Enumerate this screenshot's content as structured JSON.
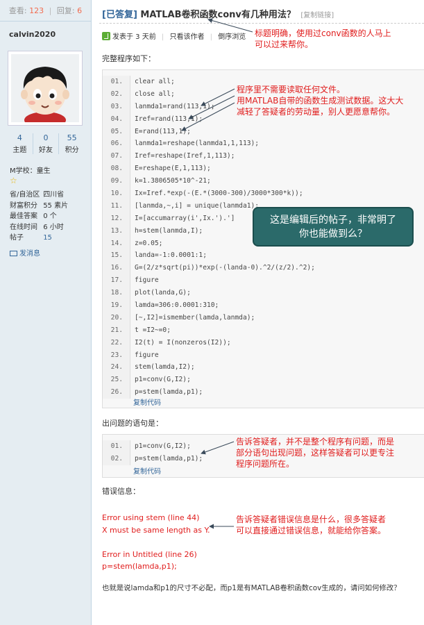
{
  "stats": {
    "views_label": "查看:",
    "views": "123",
    "replies_label": "回复:",
    "replies": "6"
  },
  "user": {
    "name": "calvin2020",
    "stats": [
      {
        "value": "4",
        "label": "主题"
      },
      {
        "value": "0",
        "label": "好友"
      },
      {
        "value": "55",
        "label": "积分"
      }
    ],
    "school": "M学校：童生",
    "profile": [
      {
        "key": "省/自治区",
        "value": "四川省",
        "blue": false
      },
      {
        "key": "财富积分",
        "value": "55 素片",
        "blue": false
      },
      {
        "key": "最佳答案",
        "value": "0 个",
        "blue": false
      },
      {
        "key": "在线时间",
        "value": "6 小时",
        "blue": false
      },
      {
        "key": "帖子",
        "value": "15",
        "blue": true
      }
    ],
    "send_message": "发消息"
  },
  "post": {
    "tag": "[已答复]",
    "title": " MATLAB卷积函数conv有几种用法？",
    "copy_link": "[复制链接]",
    "meta": {
      "posted": "发表于 3 天前",
      "only_author": "只看该作者",
      "reverse": "倒序浏览"
    },
    "intro": "完整程序如下：",
    "code1": [
      {
        "n": "01.",
        "t": "clear all;"
      },
      {
        "n": "02.",
        "t": "close all;"
      },
      {
        "n": "03.",
        "t": "lanmda1=rand(113,1);"
      },
      {
        "n": "04.",
        "t": "Iref=rand(113,1);"
      },
      {
        "n": "05.",
        "t": "E=rand(113,1);"
      },
      {
        "n": "06.",
        "t": "lanmda1=reshape(lanmda1,1,113);"
      },
      {
        "n": "07.",
        "t": "Iref=reshape(Iref,1,113);"
      },
      {
        "n": "08.",
        "t": "E=reshape(E,1,113);"
      },
      {
        "n": "09.",
        "t": "k=1.3806505*10^-21;"
      },
      {
        "n": "10.",
        "t": "Ix=Iref.*exp(-(E.*(3000-300)/3000*300*k));"
      },
      {
        "n": "11.",
        "t": "[lanmda,~,i] = unique(lanmda1);"
      },
      {
        "n": "12.",
        "t": "I=[accumarray(i',Ix.').']"
      },
      {
        "n": "13.",
        "t": "h=stem(lanmda,I);"
      },
      {
        "n": "14.",
        "t": "z=0.05;"
      },
      {
        "n": "15.",
        "t": "landa=-1:0.0001:1;"
      },
      {
        "n": "16.",
        "t": "G=(2/z*sqrt(pi))*exp(-(landa-0).^2/(z/2).^2);"
      },
      {
        "n": "17.",
        "t": "figure"
      },
      {
        "n": "18.",
        "t": "plot(landa,G);"
      },
      {
        "n": "19.",
        "t": "lamda=306:0.0001:310;"
      },
      {
        "n": "20.",
        "t": "[~,I2]=ismember(lamda,lanmda);"
      },
      {
        "n": "21.",
        "t": "t =I2~=0;"
      },
      {
        "n": "22.",
        "t": "I2(t) = I(nonzeros(I2));"
      },
      {
        "n": "23.",
        "t": "figure"
      },
      {
        "n": "24.",
        "t": "stem(lamda,I2);"
      },
      {
        "n": "25.",
        "t": "p1=conv(G,I2);"
      },
      {
        "n": "26.",
        "t": "p=stem(lamda,p1);"
      }
    ],
    "copy_code": "复制代码",
    "problem_label": "出问题的语句是：",
    "code2": [
      {
        "n": "01.",
        "t": "p1=conv(G,I2);"
      },
      {
        "n": "02.",
        "t": "p=stem(lamda,p1);"
      }
    ],
    "error_label": "错误信息：",
    "errors": [
      "Error using stem (line 44)",
      "X must be same length as Y.",
      "Error in Untitled (line 26)",
      "p=stem(lamda,p1);"
    ],
    "last_line": "也就是说lamda和p1的尺寸不必配，而p1是有MATLAB卷积函数cov生成的，请问如何修改？"
  },
  "annotations": {
    "title_note": [
      "标题明确，使用过conv函数的人马上",
      "可以过来帮你。"
    ],
    "data_note": [
      "程序里不需要读取任何文件。",
      "用MATLAB自带的函数生成测试数据。这大大",
      "减轻了答疑者的劳动量，别人更愿意帮你。"
    ],
    "callout": [
      "这是编辑后的帖子，非常明了",
      "你也能做到么？"
    ],
    "problem_note": [
      "告诉答疑者，并不是整个程序有问题，而是",
      "部分语句出现问题，这样答疑者可以更专注",
      "程序问题所在。"
    ],
    "error_note": [
      "告诉答疑者错误信息是什么，很多答疑者",
      "可以直接通过错误信息，就能给你答案。"
    ]
  },
  "colors": {
    "annotation_red": "#e01c1c",
    "link_blue": "#336699",
    "callout_teal": "#2b6a6a",
    "sidebar_bg": "#e5edf2"
  }
}
